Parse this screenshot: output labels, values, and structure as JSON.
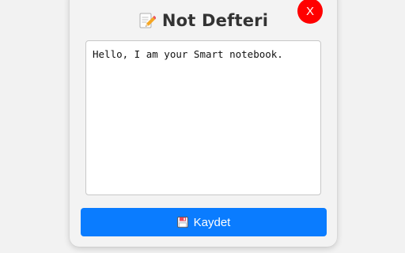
{
  "app": {
    "title": "Not Defteri",
    "title_icon": "memo-icon"
  },
  "close_button": {
    "label": "X",
    "color": "#ff0000"
  },
  "editor": {
    "value": "Hello, I am your Smart notebook."
  },
  "save_button": {
    "label": "Kaydet",
    "icon": "floppy-disk-icon",
    "color": "#0a7cff"
  }
}
